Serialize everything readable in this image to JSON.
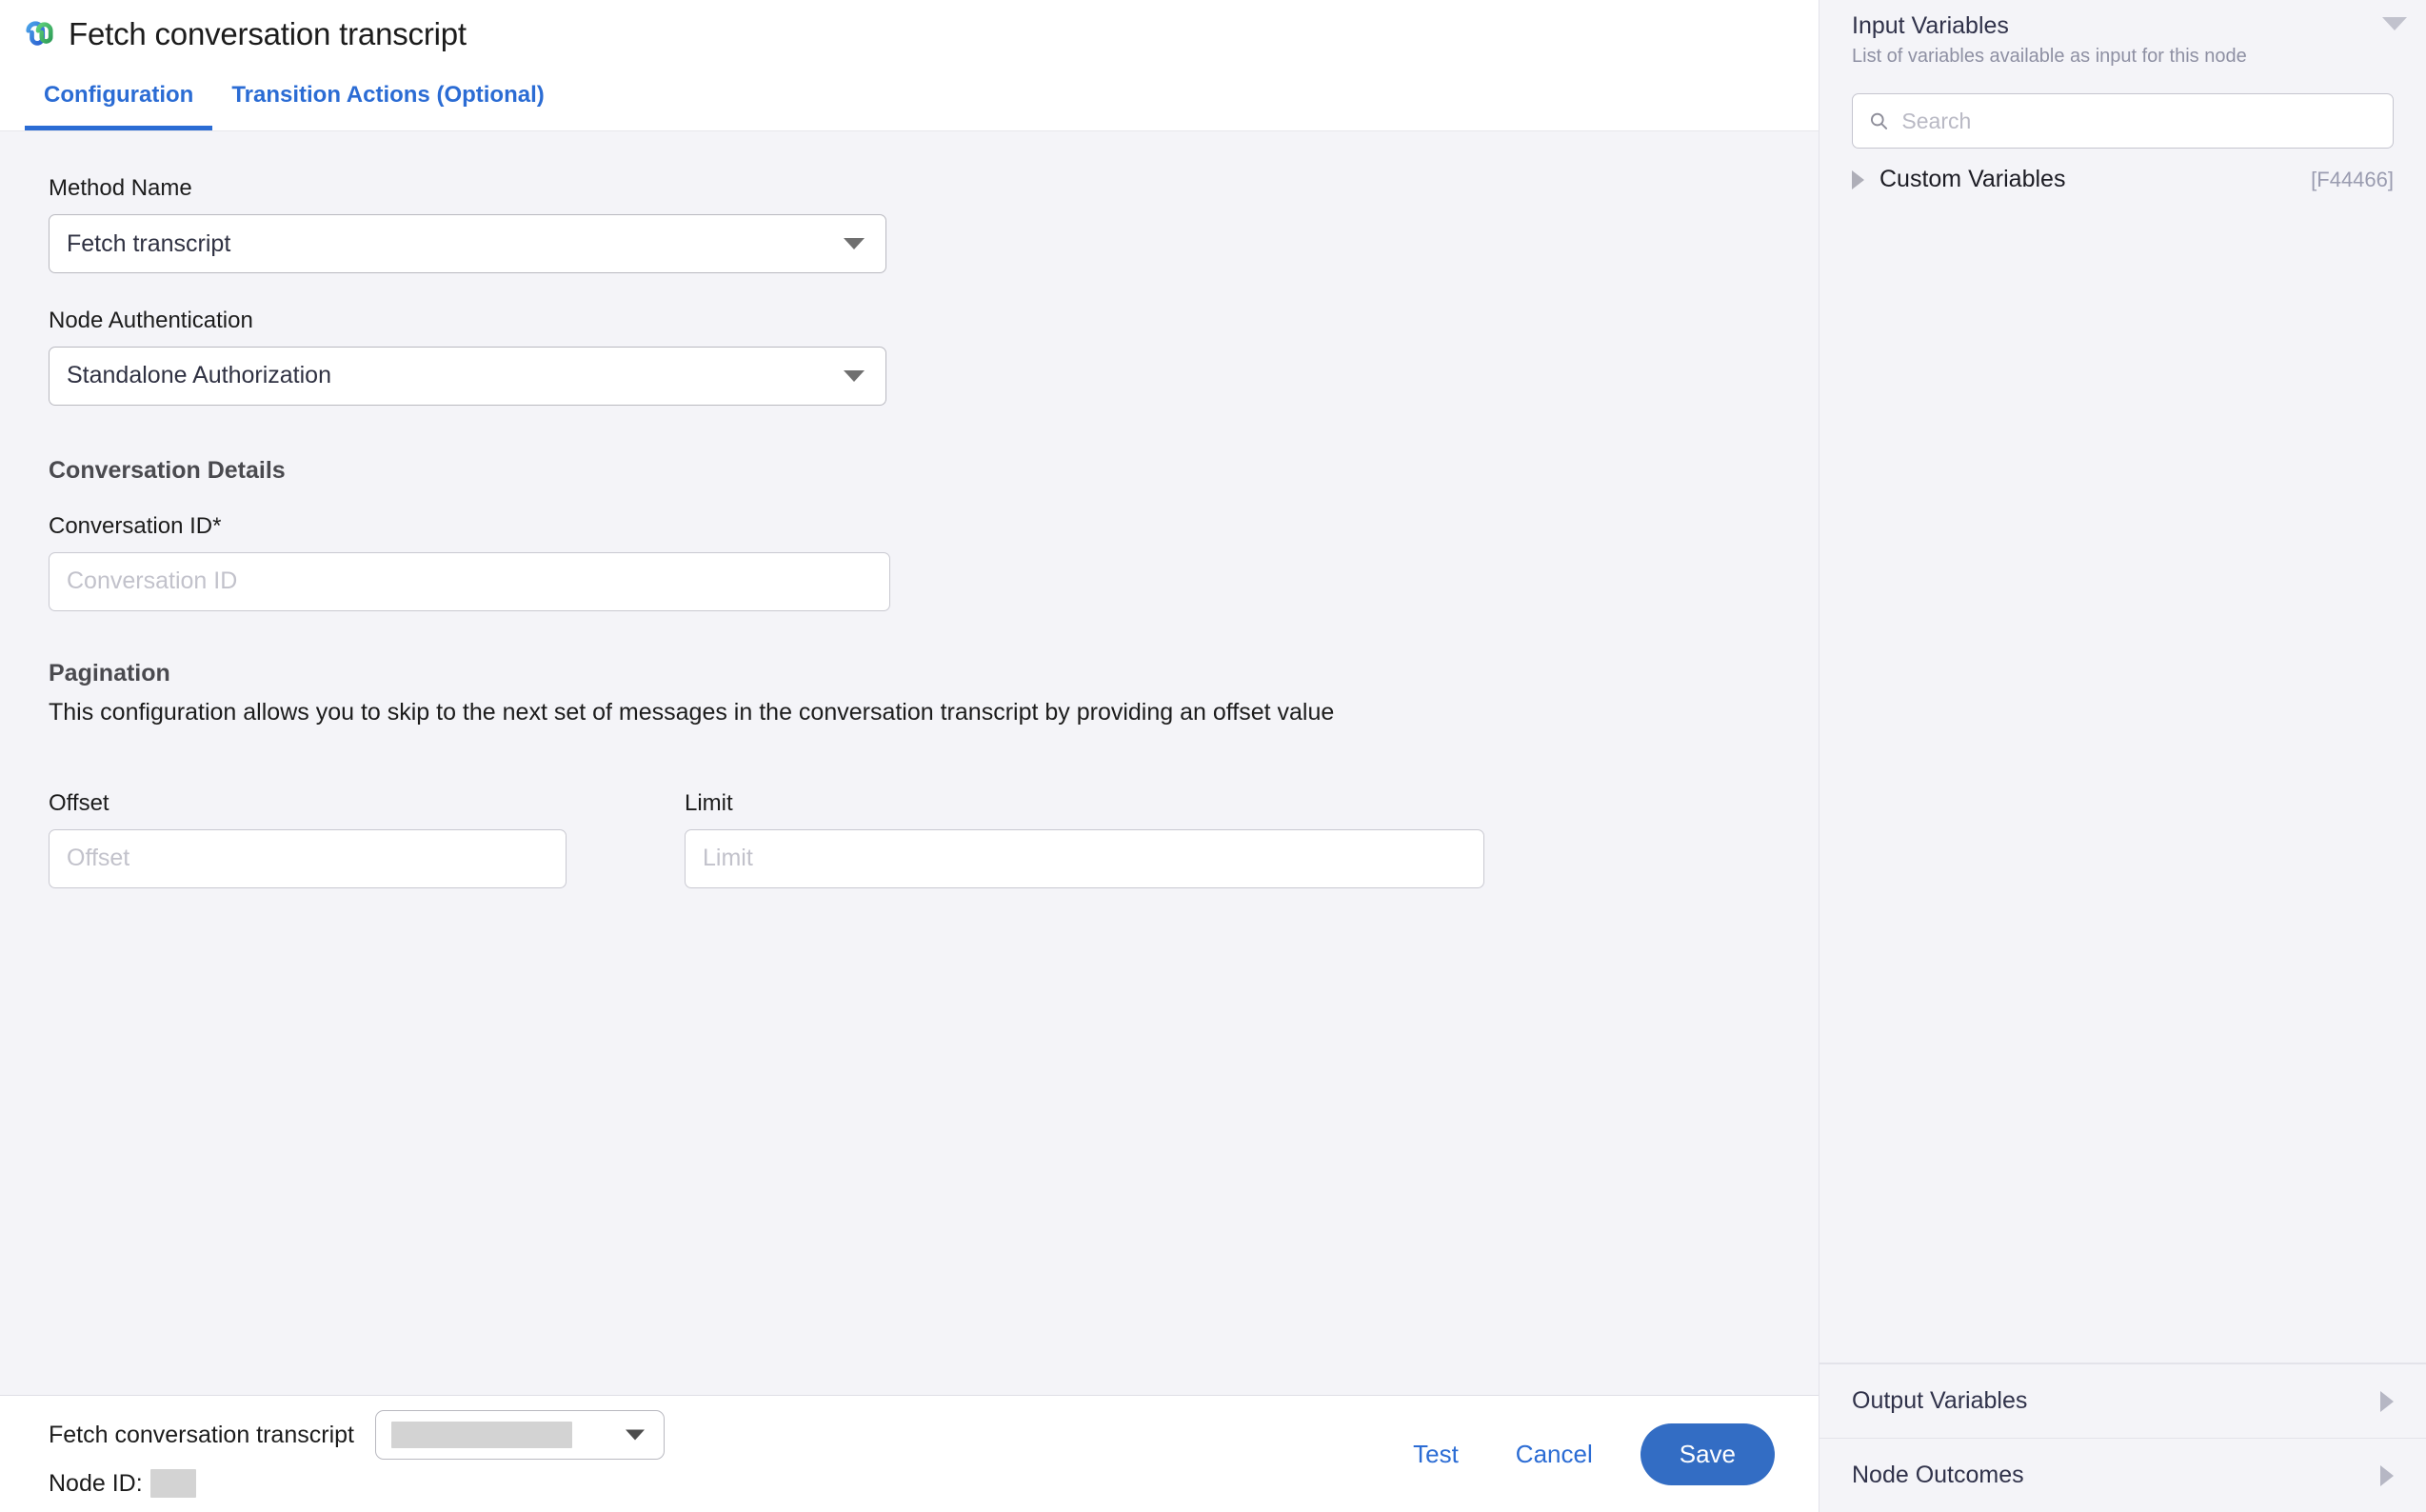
{
  "header": {
    "title": "Fetch conversation transcript",
    "logo_icon": "teams-logo-icon",
    "tabs": [
      {
        "label": "Configuration",
        "active": true
      },
      {
        "label": "Transition Actions (Optional)",
        "active": false
      }
    ]
  },
  "form": {
    "method_name": {
      "label": "Method Name",
      "value": "Fetch transcript"
    },
    "node_authentication": {
      "label": "Node Authentication",
      "value": "Standalone Authorization"
    },
    "conversation_details": {
      "section_title": "Conversation Details",
      "conversation_id": {
        "label": "Conversation ID*",
        "value": "",
        "placeholder": "Conversation ID"
      }
    },
    "pagination": {
      "section_title": "Pagination",
      "description": "This configuration allows you to skip to the next set of messages in the conversation transcript by providing an offset value",
      "offset": {
        "label": "Offset",
        "value": "",
        "placeholder": "Offset"
      },
      "limit": {
        "label": "Limit",
        "value": "",
        "placeholder": "Limit"
      }
    }
  },
  "footer": {
    "node_name": "Fetch conversation transcript",
    "node_select_value": "",
    "node_id_label": "Node ID:",
    "node_id_value": "",
    "test_label": "Test",
    "cancel_label": "Cancel",
    "save_label": "Save"
  },
  "sidebar": {
    "input_variables": {
      "title": "Input Variables",
      "subtitle": "List of variables available as input for this node",
      "search_placeholder": "Search",
      "search_value": "",
      "variables": [
        {
          "name": "Custom Variables",
          "code": "[F44466]"
        }
      ]
    },
    "sections": [
      {
        "label": "Output Variables"
      },
      {
        "label": "Node Outcomes"
      }
    ]
  },
  "colors": {
    "accent": "#2b6cd4",
    "save_button": "#336dc4",
    "panel_bg": "#f4f4f8",
    "white": "#ffffff"
  }
}
